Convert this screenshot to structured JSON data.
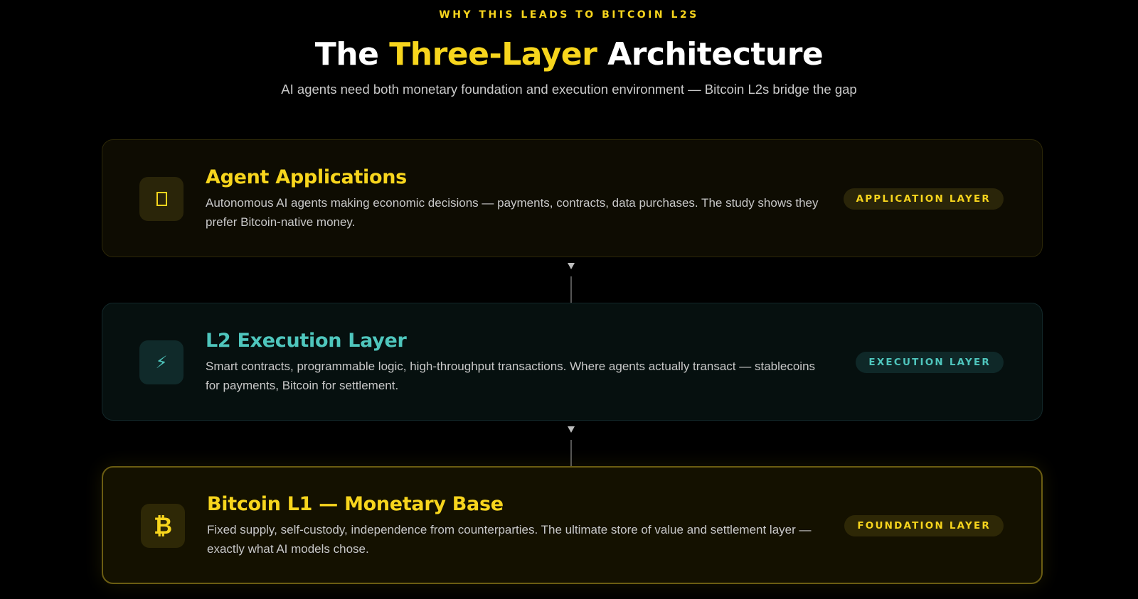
{
  "header": {
    "eyebrow": "WHY THIS LEADS TO BITCOIN L2S",
    "title_prefix": "The ",
    "title_highlight": "Three-Layer",
    "title_suffix": " Architecture",
    "subtitle": "AI agents need both monetary foundation and execution environment — Bitcoin L2s bridge the gap"
  },
  "colors": {
    "background": "#000000",
    "accent_yellow": "#f7d51d",
    "accent_teal": "#4fc6bd",
    "body_text": "#c8c8c8"
  },
  "layers": [
    {
      "icon": "square-icon",
      "title": "Agent Applications",
      "description": "Autonomous AI agents making economic decisions — payments, contracts, data purchases. The study shows they prefer Bitcoin-native money.",
      "badge": "APPLICATION LAYER"
    },
    {
      "icon": "lightning-icon",
      "icon_glyph": "⚡",
      "title": "L2 Execution Layer",
      "description": "Smart contracts, programmable logic, high-throughput transactions. Where agents actually transact — stablecoins for payments, Bitcoin for settlement.",
      "badge": "EXECUTION LAYER"
    },
    {
      "icon": "bitcoin-icon",
      "icon_glyph": "₿",
      "title": "Bitcoin L1 — Monetary Base",
      "description": "Fixed supply, self-custody, independence from counterparties. The ultimate store of value and settlement layer — exactly what AI models chose.",
      "badge": "FOUNDATION LAYER"
    }
  ]
}
